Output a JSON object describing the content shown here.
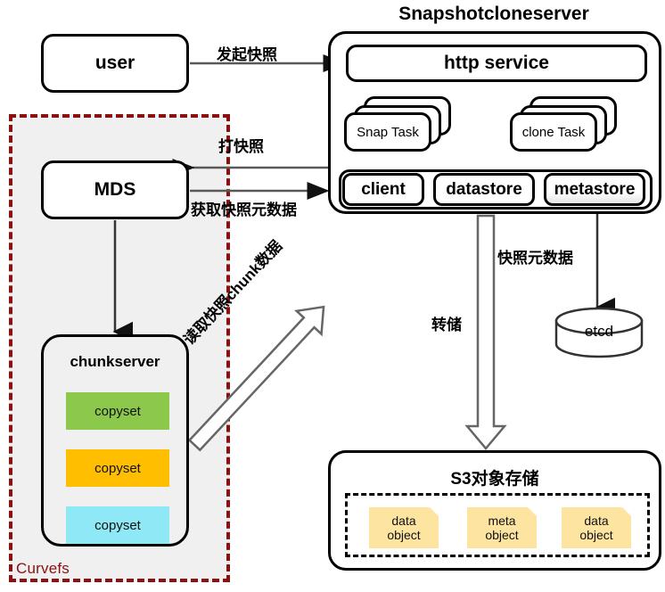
{
  "diagram": {
    "title": "Snapshotcloneserver",
    "region_label": "Curvefs"
  },
  "nodes": {
    "user": "user",
    "mds": "MDS",
    "chunkserver": "chunkserver",
    "copysets": [
      "copyset",
      "copyset",
      "copyset"
    ],
    "http_service": "http service",
    "snap_task": "Snap Task",
    "clone_task": "clone Task",
    "client": "client",
    "datastore": "datastore",
    "metastore": "metastore",
    "etcd": "etcd",
    "s3": "S3对象存储",
    "objects": [
      {
        "line1": "data",
        "line2": "object"
      },
      {
        "line1": "meta",
        "line2": "object"
      },
      {
        "line1": "data",
        "line2": "object"
      }
    ]
  },
  "flows": {
    "initiate_snapshot": "发起快照",
    "take_snapshot": "打快照",
    "get_snapshot_metadata": "获取快照元数据",
    "read_snapshot_chunk_data": "读取快照chunk数据",
    "dump": "转储",
    "snapshot_metadata": "快照元数据"
  },
  "colors": {
    "copyset_green": "#8CC84B",
    "copyset_orange": "#FFBF00",
    "copyset_cyan": "#8FE8F5",
    "curvefs_border": "#8B1111",
    "curvefs_fill": "#F0F0F0",
    "object_note": "#FDE4A0",
    "arrow_stroke": "#595959"
  }
}
